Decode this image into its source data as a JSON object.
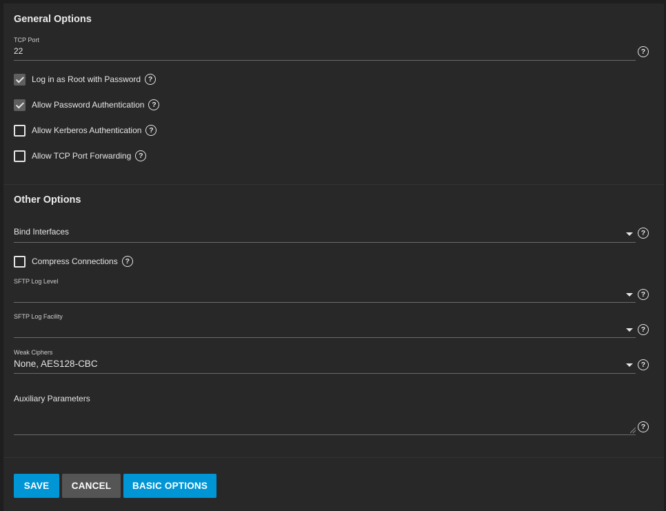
{
  "general": {
    "title": "General Options",
    "tcp_port_label": "TCP Port",
    "tcp_port_value": "22",
    "checkboxes": [
      {
        "label": "Log in as Root with Password",
        "checked": true
      },
      {
        "label": "Allow Password Authentication",
        "checked": true
      },
      {
        "label": "Allow Kerberos Authentication",
        "checked": false
      },
      {
        "label": "Allow TCP Port Forwarding",
        "checked": false
      }
    ]
  },
  "other": {
    "title": "Other Options",
    "bind_interfaces_placeholder": "Bind Interfaces",
    "compress": {
      "label": "Compress Connections",
      "checked": false
    },
    "sftp_log_level_label": "SFTP Log Level",
    "sftp_log_level_value": "",
    "sftp_log_facility_label": "SFTP Log Facility",
    "sftp_log_facility_value": "",
    "weak_ciphers_label": "Weak Ciphers",
    "weak_ciphers_value": "None, AES128-CBC",
    "aux_params_placeholder": "Auxiliary Parameters"
  },
  "help_glyph": "?",
  "icons": {
    "help": "help-circle-icon",
    "dropdown": "caret-down-icon",
    "check": "check-icon"
  },
  "actions": {
    "save": "SAVE",
    "cancel": "CANCEL",
    "basic": "BASIC OPTIONS"
  },
  "colors": {
    "background": "#1e1e1e",
    "card": "#282828",
    "primary_button": "#0095d5",
    "secondary_button": "#555555",
    "text": "#e6e6e6"
  }
}
